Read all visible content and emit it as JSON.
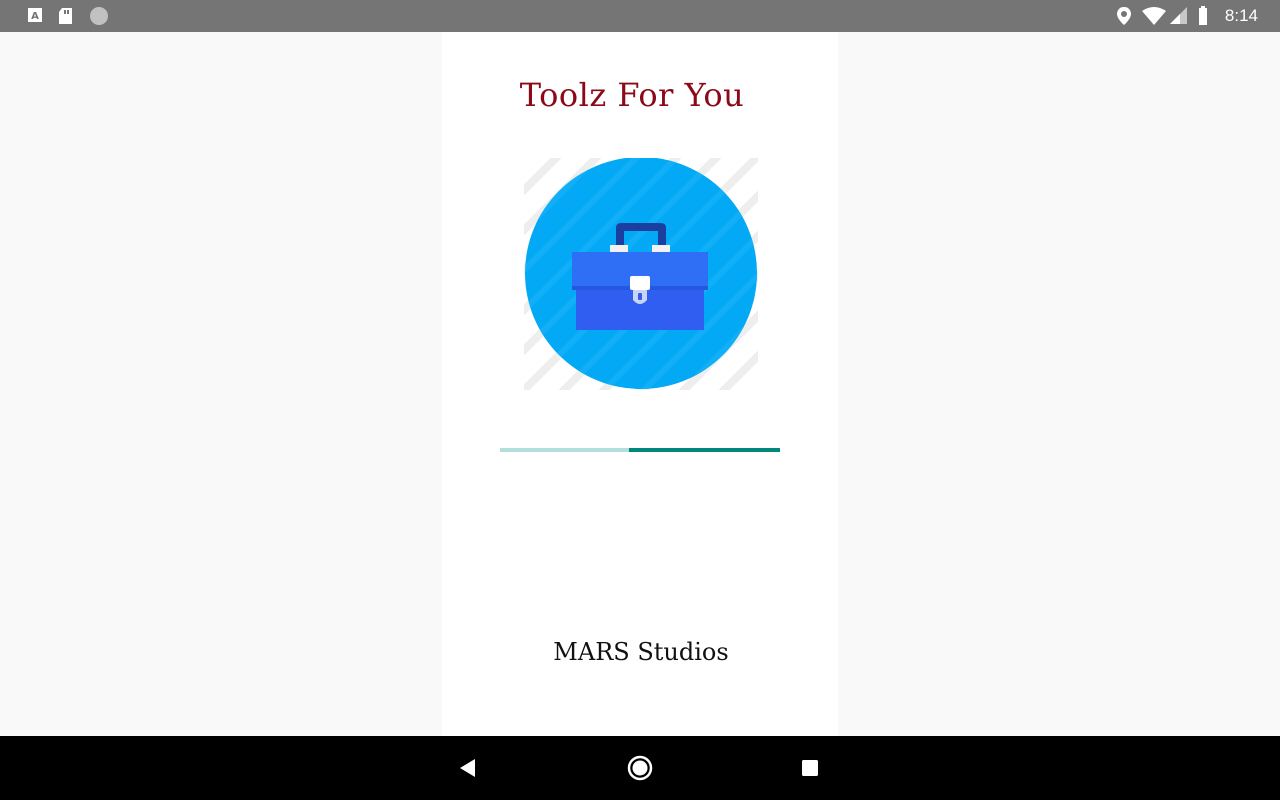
{
  "status_bar": {
    "time": "8:14",
    "icons": [
      "font-a-icon",
      "sd-card-icon",
      "circle-dot-icon",
      "location-icon",
      "wifi-icon",
      "signal-icon",
      "battery-icon"
    ]
  },
  "splash": {
    "title": "Toolz For You",
    "logo_icon": "briefcase-icon",
    "progress": {
      "indeterminate": true,
      "shown_start": 0.46,
      "shown_end": 1.0
    },
    "footer": "MARS Studios"
  },
  "nav_bar": {
    "buttons": [
      "back-icon",
      "home-icon",
      "recents-icon"
    ]
  },
  "colors": {
    "status_bar": "#757575",
    "title": "#8b0a1a",
    "logo_circle": "#03a9f4",
    "progress_track": "#b2dfdb",
    "progress_fill": "#00897b",
    "nav_bar": "#000000"
  }
}
